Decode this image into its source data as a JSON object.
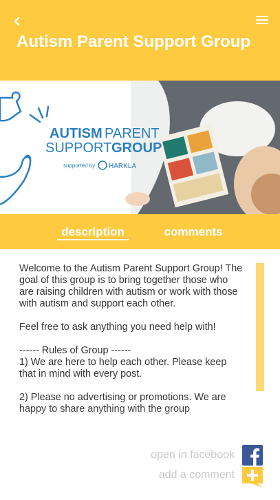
{
  "header": {
    "title": "Autism Parent Support Group",
    "back_icon": "chevron-left-icon",
    "menu_icon": "hamburger-menu-icon",
    "color": "#fdca40"
  },
  "banner": {
    "line1_a": "AUTISM",
    "line1_b": "PARENT",
    "line2_a": "SUPPORT",
    "line2_b": "GROUP",
    "supported_by": "supported by",
    "sponsor": "HARKLA"
  },
  "tabs": [
    {
      "label": "description",
      "active": true
    },
    {
      "label": "comments",
      "active": false
    }
  ],
  "description": {
    "paragraphs": [
      "Welcome to the Autism Parent Support Group! The goal of this group is to bring together those who are raising children with autism or work with those with autism and support each other.",
      "Feel free to ask anything you need help with!",
      "------ Rules of Group ------\n1) We are here to help each other. Please keep that in mind with every post.",
      "2) Please no advertising or promotions. We are happy to share anything with the group"
    ]
  },
  "actions": {
    "open_facebook": "open in facebook",
    "facebook_icon": "facebook-icon",
    "add_comment": "add a comment",
    "add_comment_icon": "add-comment-icon"
  }
}
